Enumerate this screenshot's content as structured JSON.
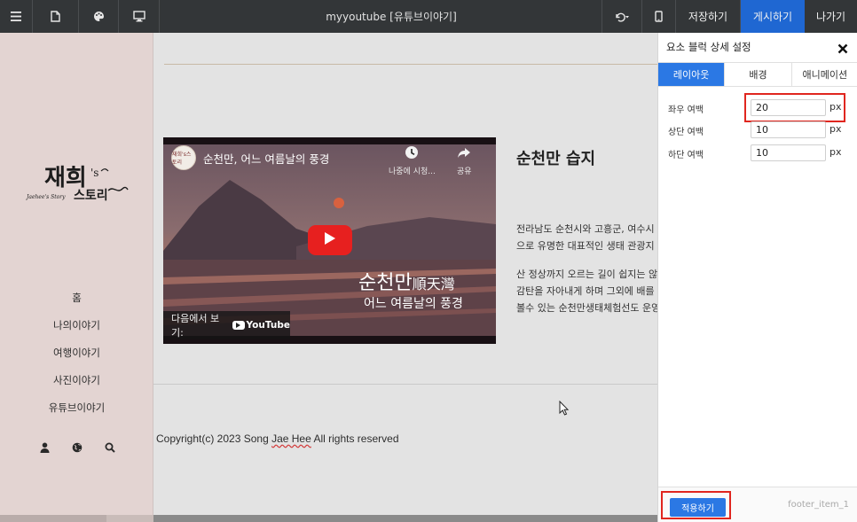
{
  "topbar": {
    "site_title": "myyoutube [유튜브이야기]",
    "save_label": "저장하기",
    "publish_label": "게시하기",
    "exit_label": "나가기",
    "icons": [
      "menu-icon",
      "page-icon",
      "palette-icon",
      "monitor-icon",
      "undo-icon",
      "mobile-icon"
    ],
    "publish_color": "#1f67d2"
  },
  "sidebar": {
    "logo_text": "재희's 스토리",
    "logo_subtext": "Jaehee's Story",
    "nav": [
      "홈",
      "나의이야기",
      "여행이야기",
      "사진이야기",
      "유튜브이야기"
    ],
    "icons": [
      "user-icon",
      "globe-icon",
      "search-icon"
    ],
    "background": "#e3d4d2"
  },
  "video": {
    "channel_badge": "재희's스토리",
    "title": "순천만, 어느 여름날의 풍경",
    "watch_later": "나중에 시청...",
    "share": "공유",
    "overlay_main": "순천만",
    "overlay_hanja": "順天灣",
    "overlay_sub": "어느 여름날의 풍경",
    "watch_on": "다음에서 보기:",
    "youtube": "YouTube"
  },
  "article": {
    "title": "순천만 습지",
    "paragraph1": [
      "전라남도 순천시와 고흥군, 여수시",
      "으로 유명한 대표적인 생태 관광지"
    ],
    "paragraph2": [
      "산 정상까지 오르는 길이 쉽지는 않",
      "감탄을 자아내게 하며 그외에 배를",
      "볼수 있는 순천만생태체험선도 운영"
    ]
  },
  "footer": {
    "copyright_before": "Copyright(c) 2023 Song ",
    "copyright_name": "Jae Hee",
    "copyright_after": " All rights reserved"
  },
  "panel": {
    "title": "요소 블럭 상세 설정",
    "tabs": [
      "레이아웃",
      "배경",
      "애니메이션"
    ],
    "active_tab": "레이아웃",
    "fields": [
      {
        "label": "좌우 여백",
        "value": "20",
        "unit": "px"
      },
      {
        "label": "상단 여백",
        "value": "10",
        "unit": "px"
      },
      {
        "label": "하단 여백",
        "value": "10",
        "unit": "px"
      }
    ],
    "apply_label": "적용하기",
    "item_id": "footer_item_1",
    "accent": "#2b78e4",
    "highlight": "#e0261f"
  }
}
